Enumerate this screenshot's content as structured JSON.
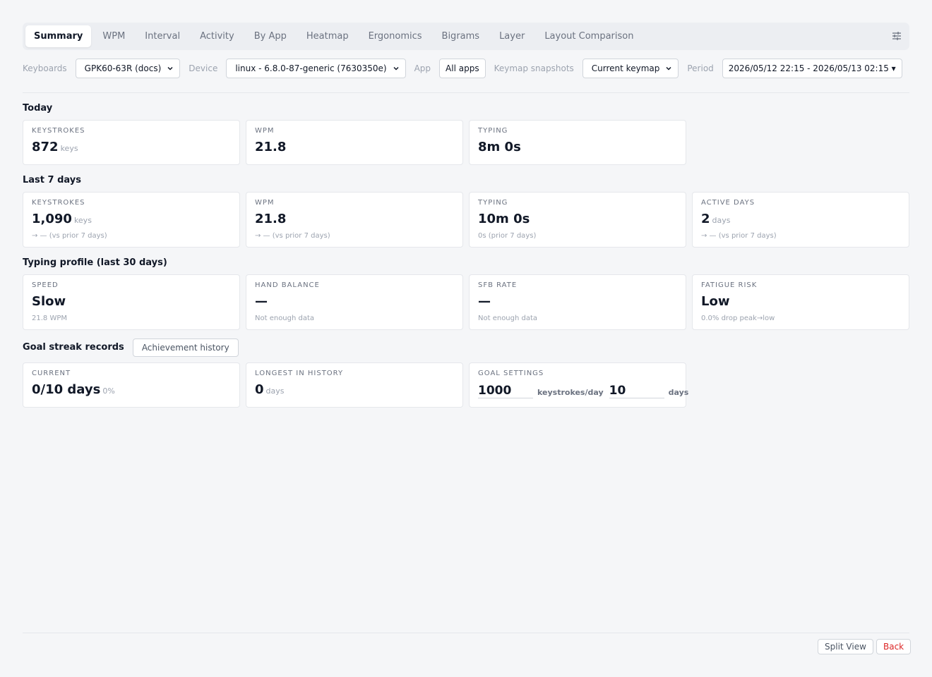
{
  "tabs": [
    {
      "label": "Summary",
      "active": true
    },
    {
      "label": "WPM"
    },
    {
      "label": "Interval"
    },
    {
      "label": "Activity"
    },
    {
      "label": "By App"
    },
    {
      "label": "Heatmap"
    },
    {
      "label": "Ergonomics"
    },
    {
      "label": "Bigrams"
    },
    {
      "label": "Layer"
    },
    {
      "label": "Layout Comparison"
    }
  ],
  "filters": {
    "keyboards_label": "Keyboards",
    "keyboards_value": "GPK60-63R (docs)",
    "device_label": "Device",
    "device_value": "linux - 6.8.0-87-generic (7630350e)",
    "app_label": "App",
    "app_value": "All apps",
    "keymap_label": "Keymap snapshots",
    "keymap_value": "Current keymap",
    "period_label": "Period",
    "period_value": "2026/05/12 22:15 - 2026/05/13 02:15 ▾"
  },
  "today": {
    "title": "Today",
    "cards": [
      {
        "label": "KEYSTROKES",
        "value": "872",
        "unit": "keys"
      },
      {
        "label": "WPM",
        "value": "21.8",
        "unit": ""
      },
      {
        "label": "TYPING",
        "value": "8m 0s",
        "unit": ""
      }
    ]
  },
  "last7": {
    "title": "Last 7 days",
    "cards": [
      {
        "label": "KEYSTROKES",
        "value": "1,090",
        "unit": "keys",
        "sub": "→ — (vs prior 7 days)"
      },
      {
        "label": "WPM",
        "value": "21.8",
        "unit": "",
        "sub": "→ — (vs prior 7 days)"
      },
      {
        "label": "TYPING",
        "value": "10m 0s",
        "unit": "",
        "sub": "0s (prior 7 days)"
      },
      {
        "label": "ACTIVE DAYS",
        "value": "2",
        "unit": "days",
        "sub": "→ — (vs prior 7 days)"
      }
    ]
  },
  "profile": {
    "title": "Typing profile (last 30 days)",
    "cards": [
      {
        "label": "SPEED",
        "value": "Slow",
        "unit": "",
        "sub": "21.8 WPM"
      },
      {
        "label": "HAND BALANCE",
        "value": "—",
        "unit": "",
        "sub": "Not enough data"
      },
      {
        "label": "SFB RATE",
        "value": "—",
        "unit": "",
        "sub": "Not enough data"
      },
      {
        "label": "FATIGUE RISK",
        "value": "Low",
        "unit": "",
        "sub": "0.0% drop peak→low"
      }
    ]
  },
  "goal": {
    "title": "Goal streak records",
    "history_button": "Achievement history",
    "current_label": "CURRENT",
    "current_value": "0/10 days",
    "current_unit": "0%",
    "longest_label": "LONGEST IN HISTORY",
    "longest_value": "0",
    "longest_unit": "days",
    "settings_label": "GOAL SETTINGS",
    "keystrokes_value": "1000",
    "keystrokes_unit": "keystrokes/day",
    "days_value": "10",
    "days_unit": "days"
  },
  "footer": {
    "split_view": "Split View",
    "back": "Back"
  },
  "colors": {
    "accent_red": "#dc2626"
  }
}
